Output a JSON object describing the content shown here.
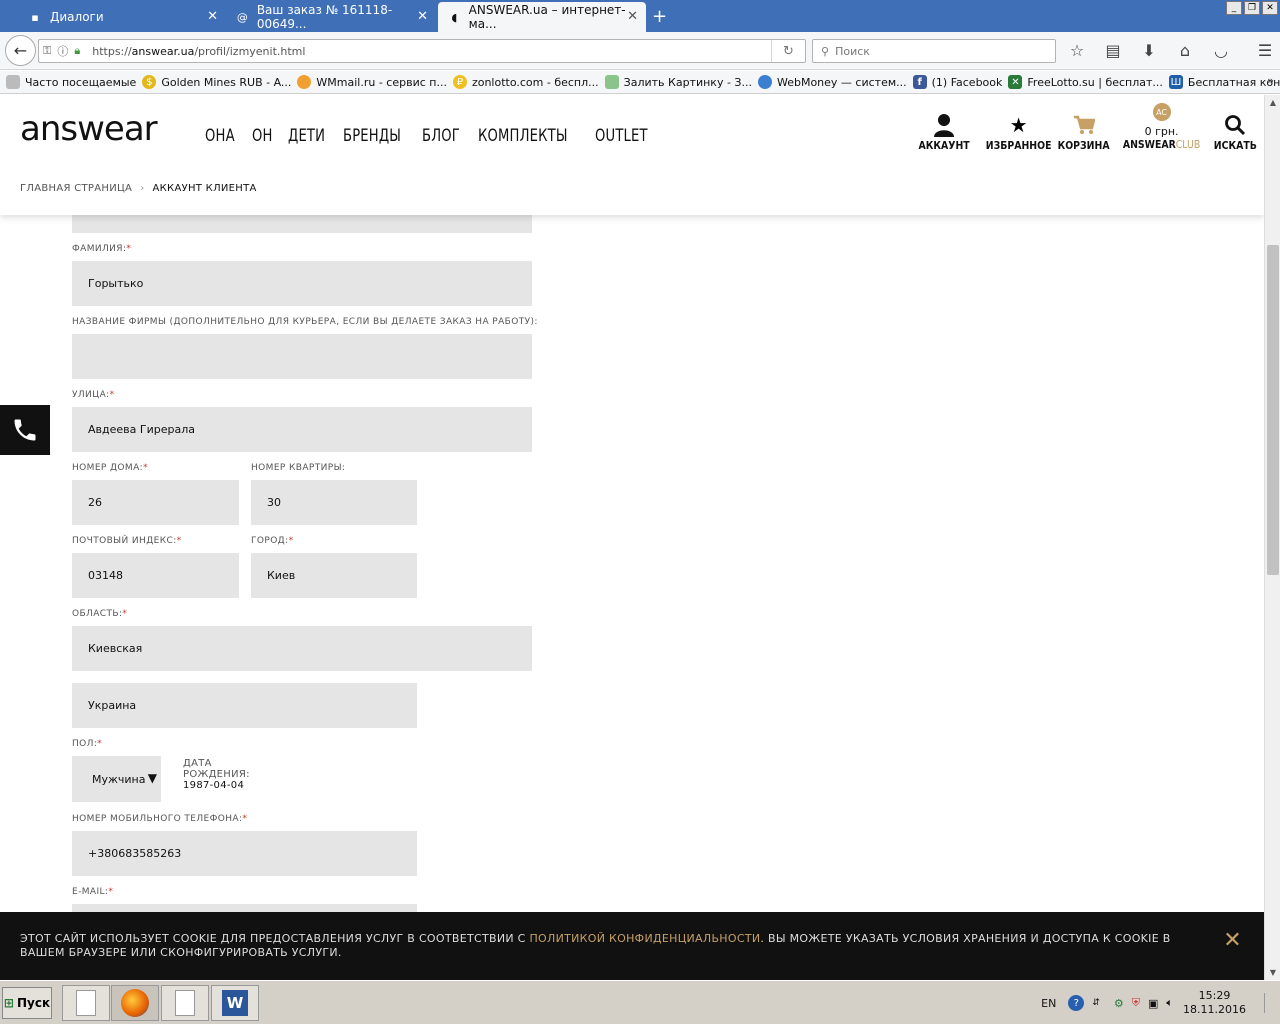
{
  "browser": {
    "tabs": [
      {
        "title": "Диалоги",
        "active": false
      },
      {
        "title": "Ваш заказ № 161118-00649...",
        "active": false
      },
      {
        "title": "ANSWEAR.ua – интернет-ма...",
        "active": true
      }
    ],
    "url_prefix": "https://",
    "url_host": "answear.ua",
    "url_path": "/profil/izmyenit.html",
    "search_placeholder": "Поиск",
    "bookmarks": [
      "Часто посещаемые",
      "Golden Mines RUB - A...",
      "WMmail.ru - сервис п...",
      "zonlotto.com - беспл...",
      "Залить Картинку - З...",
      "WebMoney — систем...",
      "(1) Facebook",
      "FreeLotto.su | бесплат...",
      "Бесплатная консуль..."
    ],
    "bookmarks_more": "»"
  },
  "site": {
    "logo": "answear",
    "nav": [
      "ОНА",
      "ОН",
      "ДЕТИ",
      "БРЕНДЫ",
      "БЛОГ",
      "КОМПЛЕКТЫ",
      "OUTLET"
    ],
    "header_icons": {
      "account": "АККАУНТ",
      "favorites": "ИЗБРАННОЕ",
      "cart": "КОРЗИНА",
      "club_badge": "AC",
      "club_sum": "0 грн.",
      "club_label_a": "ANSWEAR",
      "club_label_b": "CLUB",
      "search": "ИСКАТЬ"
    },
    "breadcrumb": [
      "ГЛАВНАЯ СТРАНИЦА",
      "АККАУНТ КЛИЕНТА"
    ]
  },
  "form": {
    "surname": {
      "label": "ФАМИЛИЯ:",
      "value": "Горытько"
    },
    "company": {
      "label": "НАЗВАНИЕ ФИРМЫ (ДОПОЛНИТЕЛЬНО ДЛЯ КУРЬЕРА, ЕСЛИ ВЫ ДЕЛАЕТЕ ЗАКАЗ НА РАБОТУ):",
      "value": ""
    },
    "street": {
      "label": "УЛИЦА:",
      "value": "Авдеева Гирерала"
    },
    "house": {
      "label": "НОМЕР ДОМА:",
      "value": "26"
    },
    "apartment": {
      "label": "НОМЕР КВАРТИРЫ:",
      "value": "30"
    },
    "postcode": {
      "label": "ПОЧТОВЫЙ ИНДЕКС:",
      "value": "03148"
    },
    "city": {
      "label": "ГОРОД:",
      "value": "Киев"
    },
    "region": {
      "label": "ОБЛАСТЬ:",
      "value": "Киевская"
    },
    "country": {
      "value": "Украина"
    },
    "gender": {
      "label": "ПОЛ:",
      "value": "Мужчина"
    },
    "birth": {
      "label": "ДАТА РОЖДЕНИЯ:",
      "value": "1987-04-04"
    },
    "phone": {
      "label": "НОМЕР МОБИЛЬНОГО ТЕЛЕФОНА:",
      "value": "+380683585263"
    },
    "email": {
      "label": "E-MAIL:"
    },
    "required_mark": "*"
  },
  "cookie": {
    "text_before": "ЭТОТ САЙТ ИСПОЛЬЗУЕТ COOKIE ДЛЯ ПРЕДОСТАВЛЕНИЯ УСЛУГ В СООТВЕТСТВИИ С ",
    "link": "ПОЛИТИКОЙ КОНФИДЕНЦИАЛЬНОСТИ",
    "text_after": ". ВЫ МОЖЕТЕ УКАЗАТЬ УСЛОВИЯ ХРАНЕНИЯ И ДОСТУПА К COOKIE В ВАШЕМ БРАУЗЕРЕ ИЛИ СКОНФИГУРИРОВАТЬ УСЛУГИ."
  },
  "taskbar": {
    "start": "Пуск",
    "lang": "EN",
    "time": "15:29",
    "date": "18.11.2016"
  },
  "colors": {
    "accent_gold": "#c6a065",
    "required": "#c0392b",
    "field_bg": "#e5e5e5"
  }
}
